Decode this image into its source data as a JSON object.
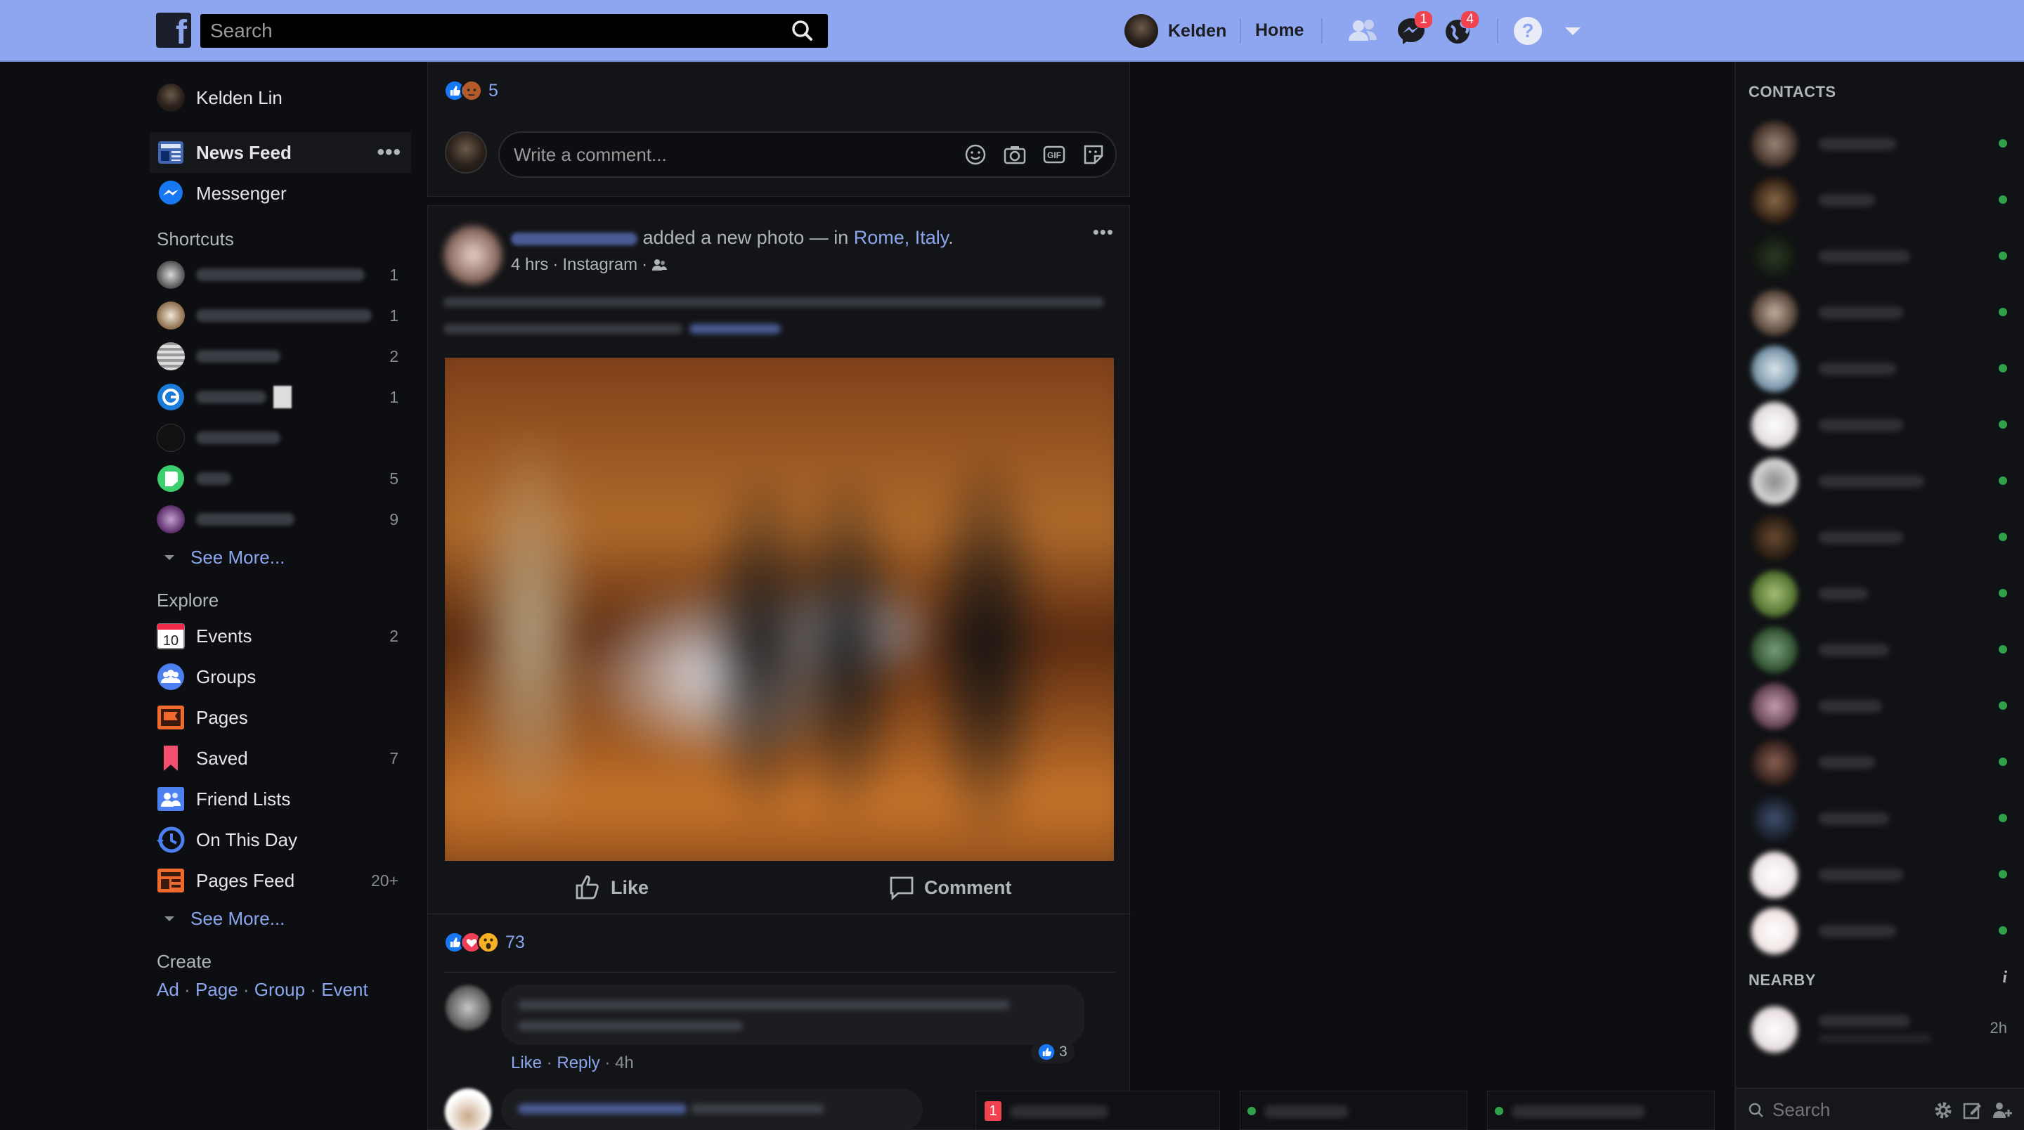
{
  "topbar": {
    "logo": "f",
    "search_placeholder": "Search",
    "profile_name": "Kelden",
    "home_label": "Home",
    "messages_badge": "1",
    "notifications_badge": "4"
  },
  "sidebar": {
    "profile_name": "Kelden Lin",
    "news_feed": "News Feed",
    "news_feed_more": "•••",
    "messenger": "Messenger",
    "shortcuts_title": "Shortcuts",
    "shortcut_counts": [
      "1",
      "1",
      "2",
      "1",
      "",
      "5",
      "9"
    ],
    "see_more_1": "See More...",
    "explore_title": "Explore",
    "explore": [
      {
        "label": "Events",
        "count": "2"
      },
      {
        "label": "Groups",
        "count": ""
      },
      {
        "label": "Pages",
        "count": ""
      },
      {
        "label": "Saved",
        "count": "7"
      },
      {
        "label": "Friend Lists",
        "count": ""
      },
      {
        "label": "On This Day",
        "count": ""
      },
      {
        "label": "Pages Feed",
        "count": "20+"
      }
    ],
    "events_icon_day": "10",
    "see_more_2": "See More...",
    "create_title": "Create",
    "create_links": [
      "Ad",
      "Page",
      "Group",
      "Event"
    ]
  },
  "feed": {
    "prev_reaction_count": "5",
    "comment_placeholder": "Write a comment...",
    "gif_label": "GIF",
    "post": {
      "action_text": "added a new photo — in",
      "location": "Rome, Italy",
      "location_end": ".",
      "time": "4 hrs",
      "source": "Instagram",
      "menu": "•••",
      "like_label": "Like",
      "comment_label": "Comment",
      "reaction_count": "73",
      "comment_like": "Like",
      "comment_reply": "Reply",
      "comment_time": "4h",
      "comment_reactions": "3"
    }
  },
  "right": {
    "contacts_title": "CONTACTS",
    "nearby_title": "NEARBY",
    "nearby_info": "i",
    "nearby_time": "2h",
    "search_placeholder": "Search"
  },
  "chat_tabs": {
    "badge": "1"
  },
  "colors": {
    "topbar": "#8ea6ef",
    "background": "#0d0e11",
    "link": "#8aa6ee",
    "online": "#31a24c",
    "badge": "#f0424f"
  }
}
